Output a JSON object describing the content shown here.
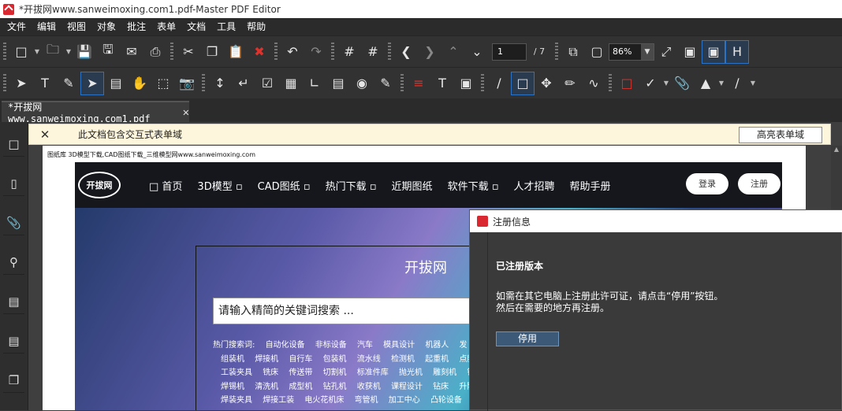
{
  "window": {
    "title": "*开拔网www.sanweimoxing.com1.pdf-Master PDF Editor"
  },
  "menu": [
    "文件",
    "编辑",
    "视图",
    "对象",
    "批注",
    "表单",
    "文档",
    "工具",
    "帮助"
  ],
  "toolbar1": {
    "page_current": "1",
    "page_total": "/ 7",
    "zoom": "86%"
  },
  "tab": {
    "label": "*开拔网www.sanweimoxing.com1.pdf",
    "close": "✕"
  },
  "notice": {
    "close": "✕",
    "message": "此文档包含交互式表单域",
    "button": "高亮表单域"
  },
  "page": {
    "header": "图纸库 3D模型下载,CAD图纸下载_三维模型网www.sanweimoxing.com",
    "site": {
      "logo": "开拔网",
      "nav": [
        "□ 首页",
        "3D模型 ▫",
        "CAD图纸 ▫",
        "热门下载 ▫",
        "近期图纸",
        "软件下载 ▫",
        "人才招聘",
        "帮助手册"
      ],
      "login": "登录",
      "register": "注册",
      "brand": "开拔网",
      "search_placeholder": "请输入精简的关键词搜索 ...",
      "hot_rows": [
        [
          "热门搜索词:",
          "自动化设备",
          "非标设备",
          "汽车",
          "模具设计",
          "机器人",
          "发"
        ],
        [
          "组装机",
          "焊接机",
          "自行车",
          "包装机",
          "流水线",
          "检测机",
          "起重机",
          "点胶"
        ],
        [
          "工装夹具",
          "铣床",
          "传送带",
          "切割机",
          "标准件库",
          "抛光机",
          "雕刻机",
          "钻"
        ],
        [
          "焊锡机",
          "清洗机",
          "成型机",
          "钻孔机",
          "收获机",
          "课程设计",
          "钻床",
          "升降"
        ],
        [
          "焊装夹具",
          "焊接工装",
          "电火花机床",
          "弯管机",
          "加工中心",
          "凸轮设备"
        ]
      ]
    }
  },
  "dialog": {
    "title": "注册信息",
    "heading": "已注册版本",
    "line1": "如需在其它电脑上注册此许可证，请点击“停用”按钮。",
    "line2": "然后在需要的地方再注册。",
    "button": "停用"
  }
}
